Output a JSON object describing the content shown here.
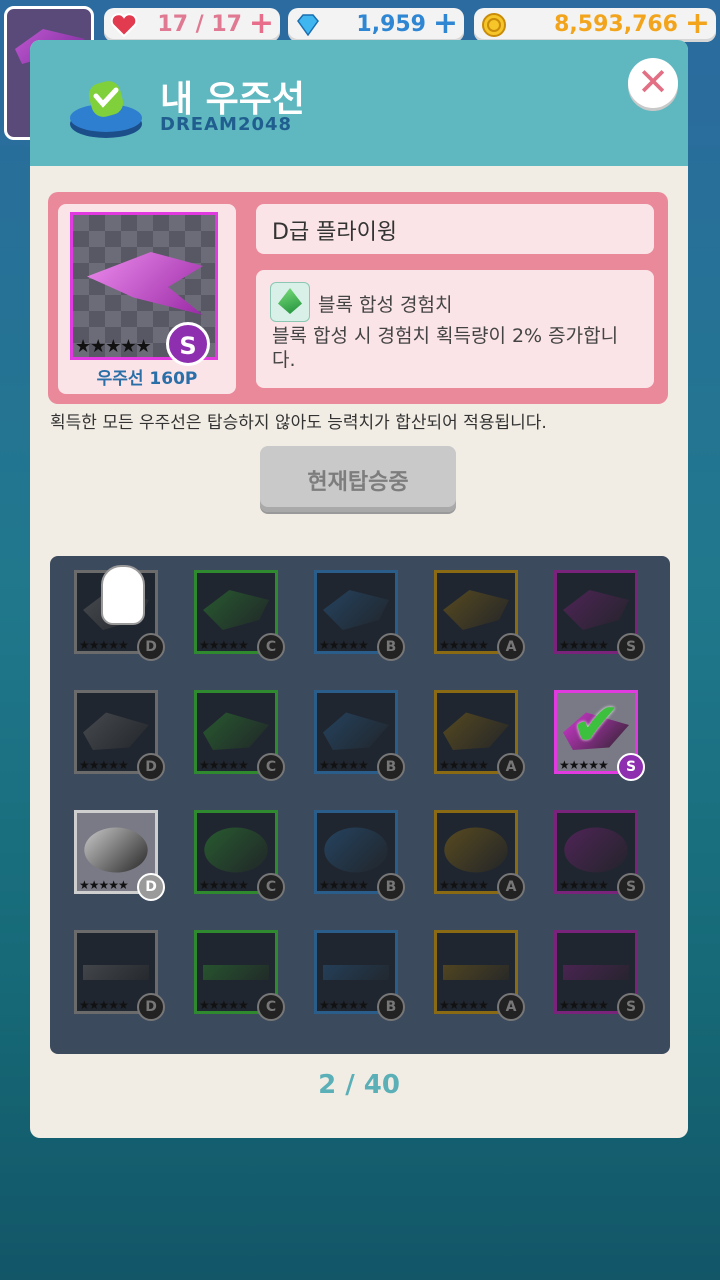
{
  "hud": {
    "hearts": "17 / 17",
    "gems": "1,959",
    "coins": "8,593,766",
    "plus": "+"
  },
  "modal": {
    "title": "내 우주선",
    "username": "DREAM2048",
    "close": "✕"
  },
  "selected": {
    "name": "D급 플라이윙",
    "points": "우주선 160P",
    "grade": "S",
    "stars": "★★★★★",
    "ability_title": "블록 합성 경험치",
    "ability_desc": "블록 합성 시 경험치 획득량이 2% 증가합니다."
  },
  "note": "획득한 모든 우주선은 탑승하지 않아도 능력치가 합산되어 적용됩니다.",
  "board_button": "현재탑승중",
  "grid": {
    "rows": [
      [
        {
          "grade": "D",
          "color": "#6b6b6b"
        },
        {
          "grade": "C",
          "color": "#2f8a2f"
        },
        {
          "grade": "B",
          "color": "#2a5d8a"
        },
        {
          "grade": "A",
          "color": "#8a6a12"
        },
        {
          "grade": "S",
          "color": "#7a237a"
        }
      ],
      [
        {
          "grade": "D",
          "color": "#6b6b6b"
        },
        {
          "grade": "C",
          "color": "#2f8a2f"
        },
        {
          "grade": "B",
          "color": "#2a5d8a"
        },
        {
          "grade": "A",
          "color": "#8a6a12"
        },
        {
          "grade": "S",
          "color": "#e03ae0",
          "owned": true,
          "selected": true
        }
      ],
      [
        {
          "grade": "D",
          "color": "#cfcfcf",
          "owned": true
        },
        {
          "grade": "C",
          "color": "#2f8a2f"
        },
        {
          "grade": "B",
          "color": "#2a5d8a"
        },
        {
          "grade": "A",
          "color": "#8a6a12"
        },
        {
          "grade": "S",
          "color": "#7a237a"
        }
      ],
      [
        {
          "grade": "D",
          "color": "#6b6b6b"
        },
        {
          "grade": "C",
          "color": "#2f8a2f"
        },
        {
          "grade": "B",
          "color": "#2a5d8a"
        },
        {
          "grade": "A",
          "color": "#8a6a12"
        },
        {
          "grade": "S",
          "color": "#7a237a"
        }
      ]
    ]
  },
  "pager": "2 / 40"
}
